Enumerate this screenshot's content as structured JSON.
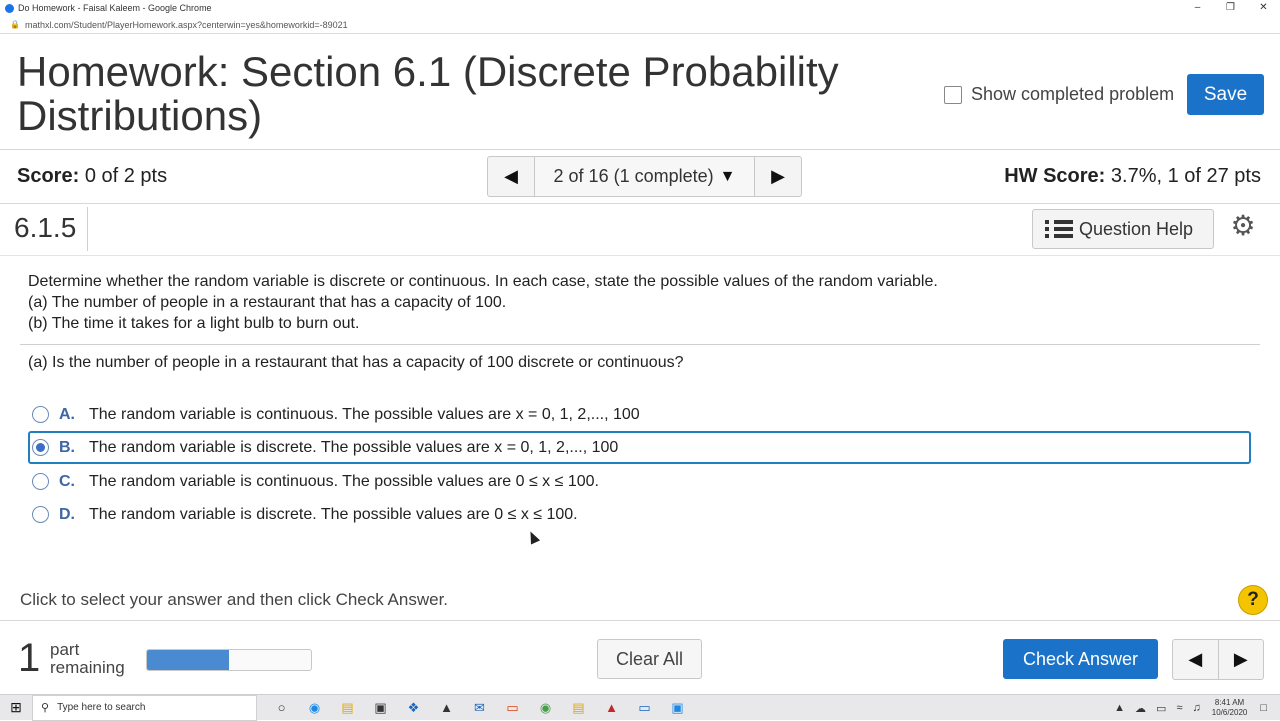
{
  "browser": {
    "window_title": "Do Homework - Faisal Kaleem - Google Chrome",
    "url": "mathxl.com/Student/PlayerHomework.aspx?centerwin=yes&homeworkid=-89021"
  },
  "header": {
    "title": "Homework: Section 6.1 (Discrete Probability Distributions)",
    "show_completed_label": "Show completed problem",
    "save_label": "Save"
  },
  "score_row": {
    "score_label": "Score:",
    "score_value": "0 of 2 pts",
    "nav_text": "2 of 16 (1 complete)",
    "hw_score_label": "HW Score:",
    "hw_score_value": "3.7%, 1 of 27 pts"
  },
  "question_header": {
    "number": "6.1.5",
    "help_label": "Question Help"
  },
  "question": {
    "line1": "Determine whether the random variable is discrete or continuous. In each case, state the possible values of the random variable.",
    "line2": "(a) The number of people in a restaurant that has a capacity of 100.",
    "line3": "(b) The time it takes for a light bulb to burn out.",
    "sub_question": "(a) Is the number of people in a restaurant that has a capacity of 100 discrete or continuous?",
    "options": [
      {
        "letter": "A.",
        "text": "The random variable is continuous. The possible values are x = 0, 1, 2,..., 100"
      },
      {
        "letter": "B.",
        "text": "The random variable is discrete. The possible values are x = 0, 1, 2,..., 100"
      },
      {
        "letter": "C.",
        "text": "The random variable is continuous. The possible values are 0 ≤ x ≤ 100."
      },
      {
        "letter": "D.",
        "text": "The random variable is discrete. The possible values are 0 ≤ x ≤ 100."
      }
    ],
    "selected_option": "B."
  },
  "footer": {
    "hint": "Click to select your answer and then click Check Answer.",
    "parts_count": "1",
    "parts_label_1": "part",
    "parts_label_2": "remaining",
    "progress_fraction": 0.5,
    "clear_all_label": "Clear All",
    "check_answer_label": "Check Answer"
  },
  "taskbar": {
    "search_placeholder": "Type here to search",
    "time": "8:41 AM",
    "date": "10/6/2020"
  },
  "colors": {
    "primary_button": "#1a73c8",
    "selected_border": "#1f7fbf",
    "option_letter": "#3f66a5",
    "help_circle": "#f5c400"
  }
}
